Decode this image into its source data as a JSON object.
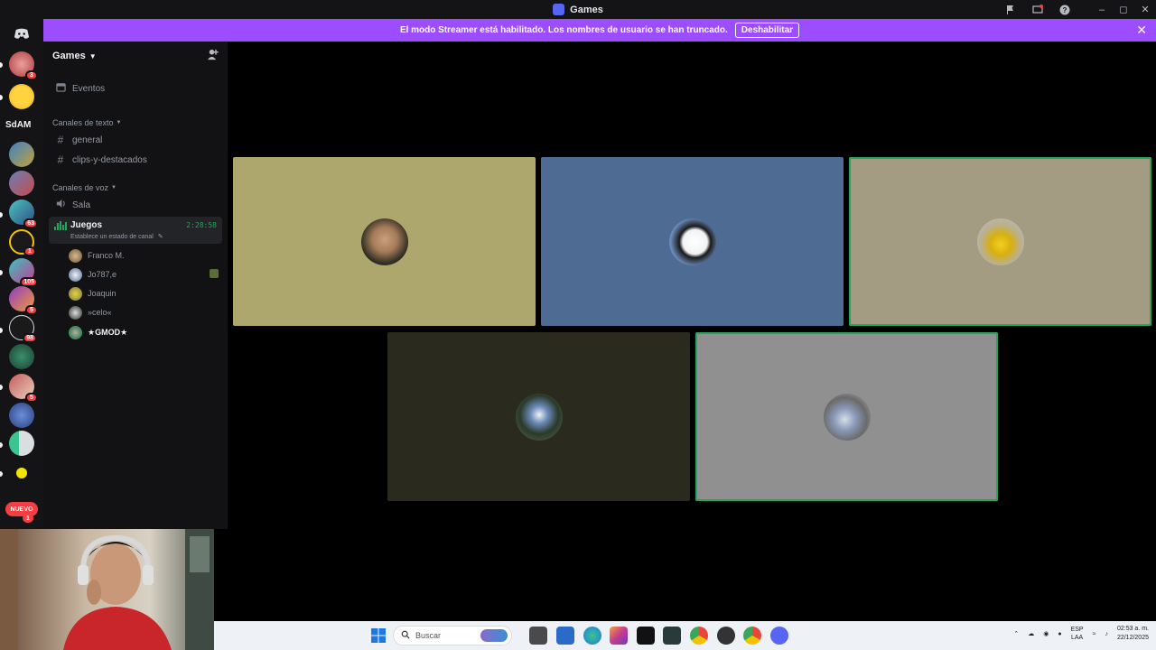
{
  "window": {
    "title": "Games"
  },
  "banner": {
    "text": "El modo Streamer está habilitado. Los nombres de usuario se han truncado.",
    "button_label": "Deshabilitar"
  },
  "rail": {
    "sdam_label": "SdAM",
    "new_label": "NUEVO",
    "badges": [
      "3",
      "63",
      "1",
      "105",
      "5",
      "98",
      "5",
      "1"
    ]
  },
  "sidebar": {
    "guild_name": "Games",
    "events_label": "Eventos",
    "text_category": "Canales de texto",
    "text_channels": [
      "general",
      "clips-y-destacados"
    ],
    "voice_category": "Canales de voz",
    "voice_channels": [
      "Sala"
    ],
    "active_voice": {
      "name": "Juegos",
      "status_hint": "Establece un estado de canal",
      "timer": "2:28:58"
    },
    "members": [
      "Franco M.",
      "Jo787,e",
      "Joaquin",
      "»celo«",
      "★GMOD★"
    ]
  },
  "taskbar": {
    "search_placeholder": "Buscar",
    "lang_top": "ESP",
    "lang_bottom": "LAA",
    "time": "02:53 a. m.",
    "date": "22/12/2025"
  },
  "colors": {
    "accent": "#5865f2",
    "banner": "#9b4dff",
    "speaking": "#23a55a",
    "tile_1": "#ada76e",
    "tile_2": "#4e6b94",
    "tile_3": "#a39c82",
    "tile_4": "#2a2b1e",
    "tile_5": "#909090"
  },
  "icons": [
    "discord-home-icon",
    "hash-icon",
    "speaker-icon",
    "calendar-icon",
    "add-member-icon",
    "close-icon",
    "pencil-icon",
    "windows-start-icon",
    "search-icon"
  ]
}
